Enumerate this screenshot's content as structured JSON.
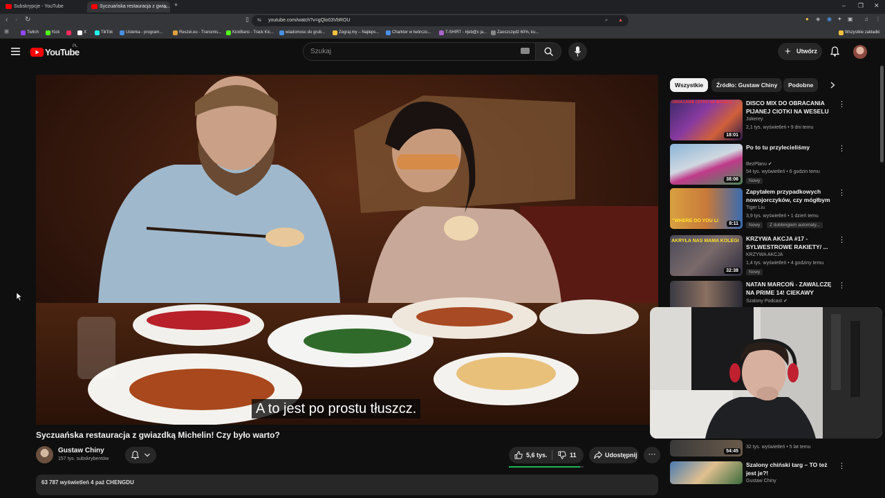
{
  "browser": {
    "tabs": [
      {
        "label": "Subskrypcje - YouTube"
      },
      {
        "label": "Syczuańska restauracja z gwia..."
      }
    ],
    "url": "youtube.com/watch?v=gQlo03VbROU",
    "bookmarks": [
      {
        "label": "Twitch",
        "color": "#9146ff"
      },
      {
        "label": "Kick",
        "color": "#53fc18"
      },
      {
        "label": "X",
        "color": "#ffffff"
      },
      {
        "label": "TikTok",
        "color": "#25f4ee"
      },
      {
        "label": "Usterka - program...",
        "color": "#4a90e2"
      },
      {
        "label": "Reszei.eu - Transmis...",
        "color": "#e0a040"
      },
      {
        "label": "KickBans - Track Kic...",
        "color": "#53fc18"
      },
      {
        "label": "wiadomosc do grub...",
        "color": "#4a90e2"
      },
      {
        "label": "Zegraj.my – Najleps...",
        "color": "#f0c040"
      },
      {
        "label": "Charkter w twórczo...",
        "color": "#4a90e2"
      },
      {
        "label": "T-SHIRT - #jeb@c ja...",
        "color": "#aa66cc"
      },
      {
        "label": "Zaoszczędź 60%, ku...",
        "color": "#888888"
      },
      {
        "label": "Wszystkie zakładki",
        "color": "#f0c040"
      }
    ]
  },
  "header": {
    "logo": "YouTube",
    "region": "PL",
    "search_placeholder": "Szukaj",
    "create_label": "Utwórz"
  },
  "video": {
    "subtitle": "A to jest po prostu tłuszcz.",
    "title": "Syczuańska restauracja z gwiazdką Michelin! Czy było warto?",
    "channel": "Gustaw Chiny",
    "subscribers": "157 tys. subskrybentów",
    "likes": "5,6 tys.",
    "dislikes": "11",
    "like_ratio": 0.95,
    "share_label": "Udostępnij",
    "description_preview": "63 787 wyświetleń  4 paź  CHENGDU"
  },
  "sidebar": {
    "chips": [
      "Wszystkie",
      "Źródło: Gustaw Chiny",
      "Podobne"
    ],
    "recommendations": [
      {
        "title": "DISCO MIX DO OBRACANIA PIJANEJ CIOTKI NA WESELU",
        "channel": "Jokerey",
        "meta": "2,1 tys. wyświetleń • 9 dni temu",
        "duration": "18:01",
        "thumb_text": "OBRACANIE CIOTKI NA WESELU",
        "badges": []
      },
      {
        "title": "Po to tu przylecieliśmy",
        "channel": "BezPlanu",
        "meta": "54 tys. wyświetleń • 6 godzin temu",
        "duration": "38:06",
        "thumb_text": "",
        "badges": [
          "Nowy"
        ]
      },
      {
        "title": "Zapytałem przypadkowych nowojorczyków, czy mógłbym ...",
        "channel": "Tiger Liu",
        "meta": "3,9 tys. wyświetleń • 1 dzień temu",
        "duration": "8:11",
        "thumb_text": "\"WHERE DO YOU LI",
        "badges": [
          "Nowy",
          "Z dubbingiem automaty..."
        ]
      },
      {
        "title": "KRZYWA AKCJA #17 - SYLWESTROWE RAKIETY/ ...",
        "channel": "KRZYWA AKCJA",
        "meta": "1,4 tys. wyświetleń • 4 godziny temu",
        "duration": "32:38",
        "thumb_text": "AKRYŁA NAS MAMA KOLEGI",
        "badges": [
          "Nowy"
        ]
      },
      {
        "title": "NATAN MARCOŃ - ZAWALCZĘ NA PRIME 14! CIEKAWY FILMI...",
        "channel": "Szalony Podcast",
        "meta": "",
        "duration": "",
        "thumb_text": "",
        "badges": []
      },
      {
        "title": "",
        "channel": "",
        "meta": "32 tys. wyświetleń • 5 lat temu",
        "duration": "54:45",
        "thumb_text": "",
        "badges": []
      },
      {
        "title": "Szalony chiński targ – TO też jest je?!",
        "channel": "Gustaw Chiny",
        "meta": "",
        "duration": "",
        "thumb_text": "",
        "badges": []
      }
    ]
  },
  "colors": {
    "accent": "#ff0000",
    "background": "#0f0f0f",
    "surface": "#272727",
    "like_bar": "#1db954"
  }
}
